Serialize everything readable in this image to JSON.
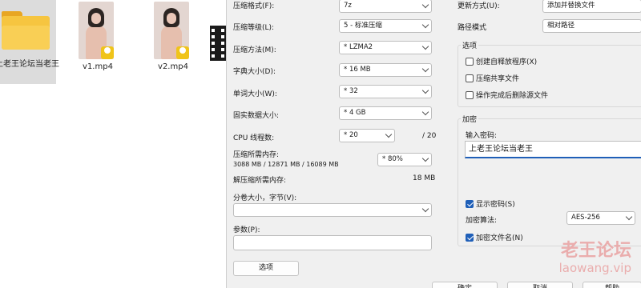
{
  "desktop": {
    "files": [
      {
        "label": "上老王论坛当老王",
        "type": "folder"
      },
      {
        "label": "v1.mp4",
        "type": "video",
        "badge": "Flare"
      },
      {
        "label": "v2.mp4",
        "type": "video",
        "badge": "Flare"
      }
    ]
  },
  "dialog": {
    "left": {
      "format": {
        "label": "压缩格式(F):",
        "value": "7z"
      },
      "level": {
        "label": "压缩等级(L):",
        "value": "5 - 标准压缩"
      },
      "method": {
        "label": "压缩方法(M):",
        "value": "* LZMA2"
      },
      "dict": {
        "label": "字典大小(D):",
        "value": "* 16 MB"
      },
      "word": {
        "label": "单词大小(W):",
        "value": "* 32"
      },
      "solid": {
        "label": "固实数据大小:",
        "value": "* 4 GB"
      },
      "threads": {
        "label": "CPU 线程数:",
        "value": "* 20",
        "max": "/ 20"
      },
      "mem_compress": {
        "label": "压缩所需内存:",
        "detail": "3088 MB / 12871 MB / 16089 MB",
        "value": "* 80%"
      },
      "mem_decompress": {
        "label": "解压缩所需内存:",
        "value": "18 MB"
      },
      "volume": {
        "label": "分卷大小，字节(V):",
        "value": ""
      },
      "params": {
        "label": "参数(P):",
        "value": ""
      },
      "options_button": "选项"
    },
    "right": {
      "update": {
        "label": "更新方式(U):",
        "value": "添加并替换文件"
      },
      "pathmode": {
        "label": "路径模式",
        "value": "相对路径"
      },
      "options_group": {
        "title": "选项",
        "sfx": "创建自释放程序(X)",
        "shared": "压缩共享文件",
        "delete": "操作完成后删除源文件"
      },
      "encrypt_group": {
        "title": "加密",
        "pwd_label": "输入密码:",
        "pwd_value": "上老王论坛当老王",
        "show_pwd": "显示密码(S)",
        "algo_label": "加密算法:",
        "algo_value": "AES-256",
        "encrypt_names": "加密文件名(N)"
      }
    },
    "buttons": {
      "ok": "确定",
      "cancel": "取消",
      "help": "帮助"
    }
  },
  "watermark": {
    "title": "老王论坛",
    "url": "laowang.vip"
  }
}
